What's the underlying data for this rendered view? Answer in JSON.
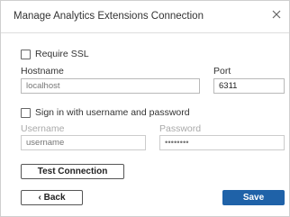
{
  "dialog": {
    "title": "Manage Analytics Extensions Connection",
    "close_icon": "close-icon"
  },
  "ssl": {
    "label": "Require SSL",
    "checked": false
  },
  "hostname": {
    "label": "Hostname",
    "value": "localhost"
  },
  "port": {
    "label": "Port",
    "value": "6311"
  },
  "auth": {
    "label": "Sign in with username and password",
    "checked": false,
    "username_label": "Username",
    "username_placeholder": "username",
    "password_label": "Password",
    "password_mask": "••••••••"
  },
  "buttons": {
    "test_connection": "Test Connection",
    "back": "‹ Back",
    "save": "Save"
  },
  "colors": {
    "primary": "#1f62a8",
    "border": "#cfcfcf"
  }
}
